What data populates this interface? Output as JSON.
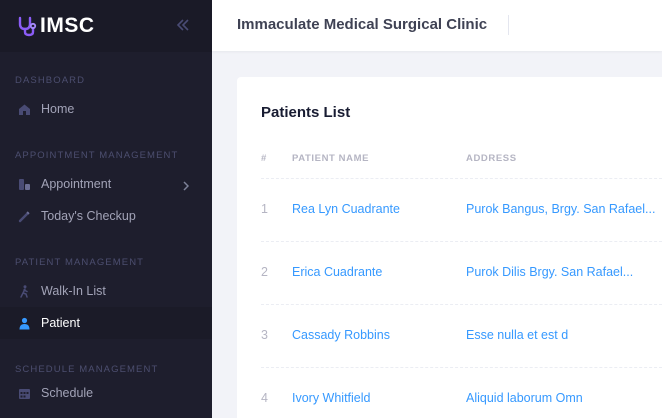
{
  "brand": {
    "name": "IMSC"
  },
  "header": {
    "title": "Immaculate Medical Surgical Clinic"
  },
  "sidebar": {
    "sections": {
      "dashboard": "DASHBOARD",
      "appointment": "APPOINTMENT MANAGEMENT",
      "patient": "PATIENT MANAGEMENT",
      "schedule": "SCHEDULE MANAGEMENT"
    },
    "items": {
      "home": "Home",
      "appointment": "Appointment",
      "checkup": "Today's Checkup",
      "walkin": "Walk-In List",
      "patient": "Patient",
      "schedule": "Schedule"
    },
    "active_item": "Patient"
  },
  "patients": {
    "title": "Patients List",
    "columns": {
      "num": "#",
      "name": "PATIENT NAME",
      "address": "ADDRESS"
    },
    "rows": [
      {
        "num": "1",
        "name": "Rea Lyn Cuadrante",
        "address": "Purok Bangus, Brgy. San Rafael..."
      },
      {
        "num": "2",
        "name": "Erica Cuadrante",
        "address": "Purok Dilis Brgy. San Rafael..."
      },
      {
        "num": "3",
        "name": "Cassady Robbins",
        "address": "Esse nulla et est d"
      },
      {
        "num": "4",
        "name": "Ivory Whitfield",
        "address": "Aliquid laborum Omn"
      }
    ]
  },
  "colors": {
    "sidebar_bg": "#1e1e2d",
    "accent": "#3699ff",
    "brand_icon": "#a78bfa"
  }
}
